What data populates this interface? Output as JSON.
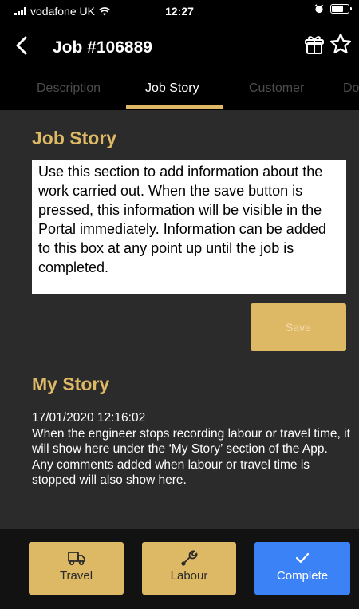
{
  "status_bar": {
    "carrier": "vodafone UK",
    "time": "12:27"
  },
  "header": {
    "title": "Job #106889",
    "icons": [
      "back-chevron-icon",
      "gift-icon",
      "star-icon"
    ]
  },
  "tabs": [
    {
      "label": "Description",
      "active": false
    },
    {
      "label": "Job Story",
      "active": true
    },
    {
      "label": "Customer",
      "active": false
    },
    {
      "label": "Do",
      "active": false
    }
  ],
  "job_story": {
    "title": "Job Story",
    "text": "Use this section to add information about the work carried out. When the save button is pressed, this information will be visible in the Portal immediately. Information can be added to this box at any point up until the job is completed.",
    "save_label": "Save"
  },
  "my_story": {
    "title": "My Story",
    "entries": [
      {
        "timestamp": "17/01/2020 12:16:02",
        "text": "When the engineer stops recording labour or travel time, it will show here under the ‘My Story’ section of the App. Any comments added when labour or travel time is stopped will also show here."
      }
    ]
  },
  "actions": {
    "travel_label": "Travel",
    "labour_label": "Labour",
    "complete_label": "Complete"
  },
  "colors": {
    "accent": "#ddb865",
    "complete": "#3b82f6",
    "background": "#2b2b2b",
    "header": "#000000"
  }
}
